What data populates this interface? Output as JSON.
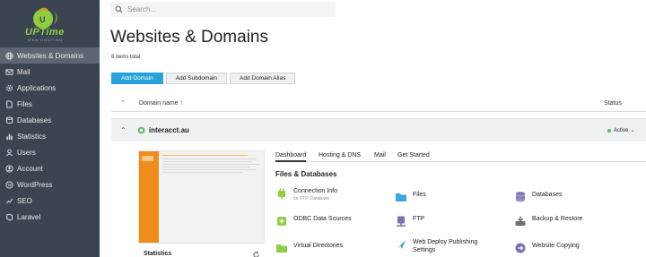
{
  "brand": {
    "name": "UPTime",
    "tagline": "WEB HOSTING",
    "accent_color": "#8fcf3f"
  },
  "sidebar": {
    "items": [
      {
        "label": "Websites & Domains",
        "icon": "globe-icon",
        "active": true
      },
      {
        "label": "Mail",
        "icon": "mail-icon"
      },
      {
        "label": "Applications",
        "icon": "gear-icon"
      },
      {
        "label": "Files",
        "icon": "file-icon"
      },
      {
        "label": "Databases",
        "icon": "database-icon"
      },
      {
        "label": "Statistics",
        "icon": "bar-chart-icon"
      },
      {
        "label": "Users",
        "icon": "user-icon"
      },
      {
        "label": "Account",
        "icon": "account-icon"
      },
      {
        "label": "WordPress",
        "icon": "wordpress-icon"
      },
      {
        "label": "SEO",
        "icon": "seo-icon"
      },
      {
        "label": "Laravel",
        "icon": "laravel-icon"
      }
    ]
  },
  "search": {
    "placeholder": "Search..."
  },
  "page": {
    "title": "Websites & Domains",
    "items_total": "6 items total"
  },
  "actions": {
    "add_domain": "Add Domain",
    "add_subdomain": "Add Subdomain",
    "add_domain_alias": "Add Domain Alias"
  },
  "table": {
    "col_domain": "Domain name ↑",
    "col_status": "Status"
  },
  "domain": {
    "name": "interacct.au",
    "status": "Active",
    "status_color": "#5cb85c"
  },
  "preview": {
    "statistics_label": "Statistics"
  },
  "tabs": [
    "Dashboard",
    "Hosting & DNS",
    "Mail",
    "Get Started"
  ],
  "section": {
    "title": "Files & Databases"
  },
  "tools": [
    {
      "name": "Connection Info",
      "sub": "for FTP, Database",
      "icon": "connection-icon"
    },
    {
      "name": "Files",
      "sub": "",
      "icon": "folder-icon"
    },
    {
      "name": "Databases",
      "sub": "",
      "icon": "database-icon"
    },
    {
      "name": "ODBC Data Sources",
      "sub": "",
      "icon": "odbc-icon"
    },
    {
      "name": "FTP",
      "sub": "",
      "icon": "ftp-icon"
    },
    {
      "name": "Backup & Restore",
      "sub": "",
      "icon": "backup-icon"
    },
    {
      "name": "Virtual Directories",
      "sub": "",
      "icon": "virtual-dir-icon"
    },
    {
      "name": "Web Deploy Publishing",
      "name2": "Settings",
      "sub": "",
      "icon": "web-deploy-icon"
    },
    {
      "name": "Website Copying",
      "sub": "",
      "icon": "website-copy-icon"
    }
  ]
}
